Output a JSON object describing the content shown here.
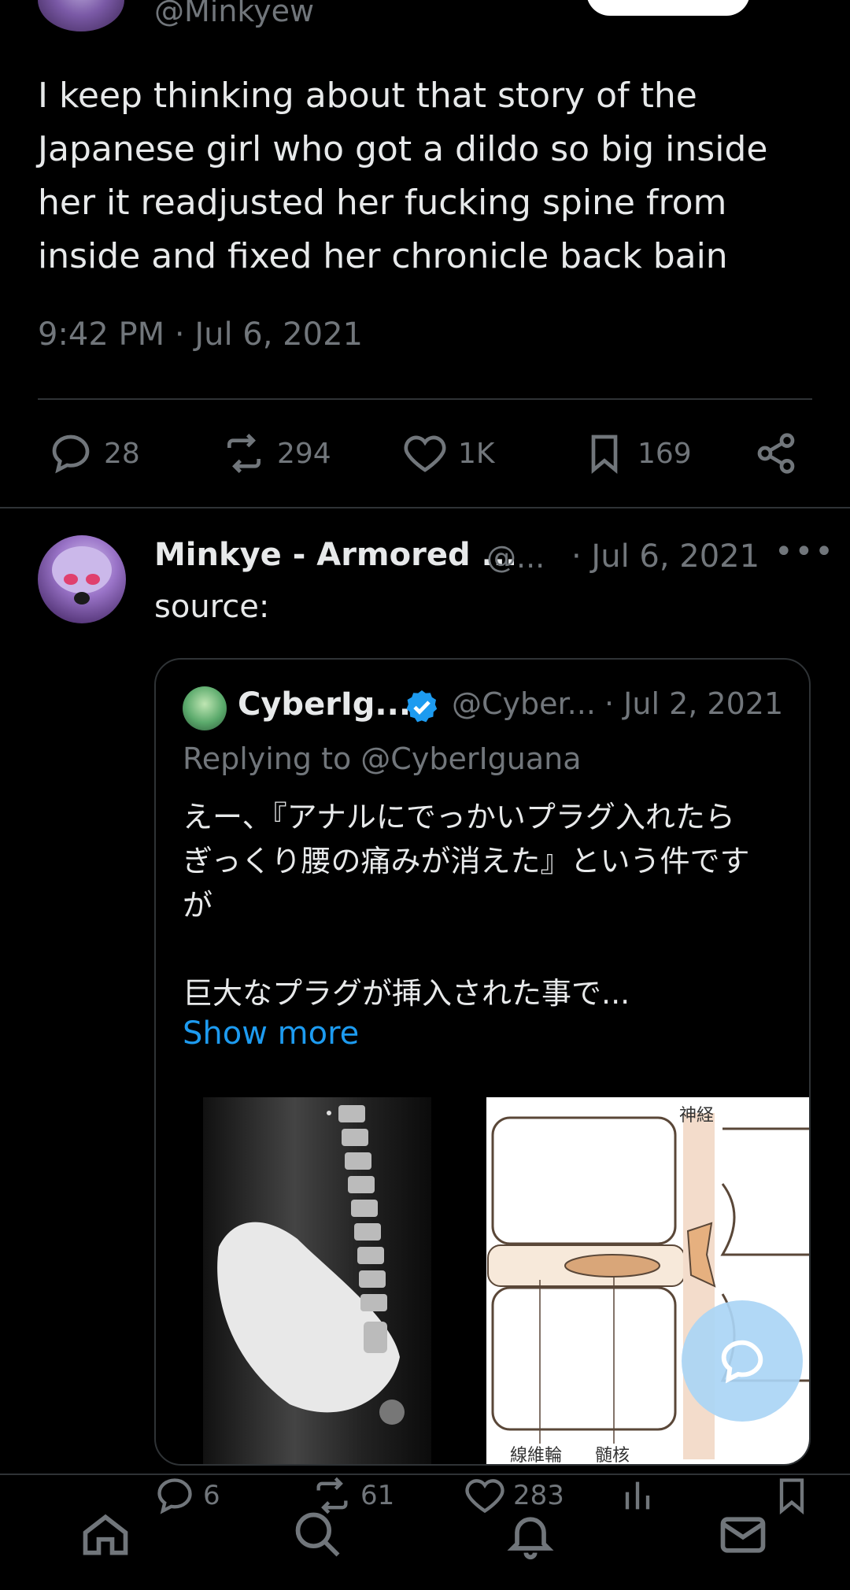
{
  "tweet": {
    "handle": "@Minkyew",
    "text": "I keep thinking about that story of the\nJapanese girl who got a dildo so big inside\nher it readjusted her fucking spine from\ninside and fixed her chronicle back bain",
    "timestamp": "9:42 PM · Jul 6, 2021",
    "stats": {
      "replies": "28",
      "retweets": "294",
      "likes": "1K",
      "bookmarks": "169"
    }
  },
  "reply": {
    "name": "Minkye - Armored ...",
    "handle": "@...",
    "date": "· Jul 6, 2021",
    "more": "•••",
    "text": "source:",
    "stats": {
      "replies": "6",
      "retweets": "61",
      "likes": "283"
    }
  },
  "quote": {
    "name": "CyberIg...",
    "handle": "@Cyber...",
    "date": "· Jul 2, 2021",
    "replying_to": "Replying to @CyberIguana",
    "text": "えー、『アナルにでっかいプラグ入れたら\nぎっくり腰の痛みが消えた』という件です\nが\n\n巨大なプラグが挿入された事で...",
    "show_more": "Show more",
    "diagram_labels": {
      "nerve": "神経",
      "annulus": "線維輪",
      "nucleus": "髄核"
    }
  },
  "colors": {
    "accent": "#1d9bf0",
    "muted": "#71767b",
    "text": "#e7e9ea",
    "background": "#000000"
  },
  "icons": [
    "reply-icon",
    "retweet-icon",
    "heart-icon",
    "bookmark-icon",
    "share-icon",
    "verified-badge-icon",
    "home-icon",
    "search-icon",
    "bell-icon",
    "mail-icon",
    "analytics-icon",
    "compose-icon"
  ]
}
